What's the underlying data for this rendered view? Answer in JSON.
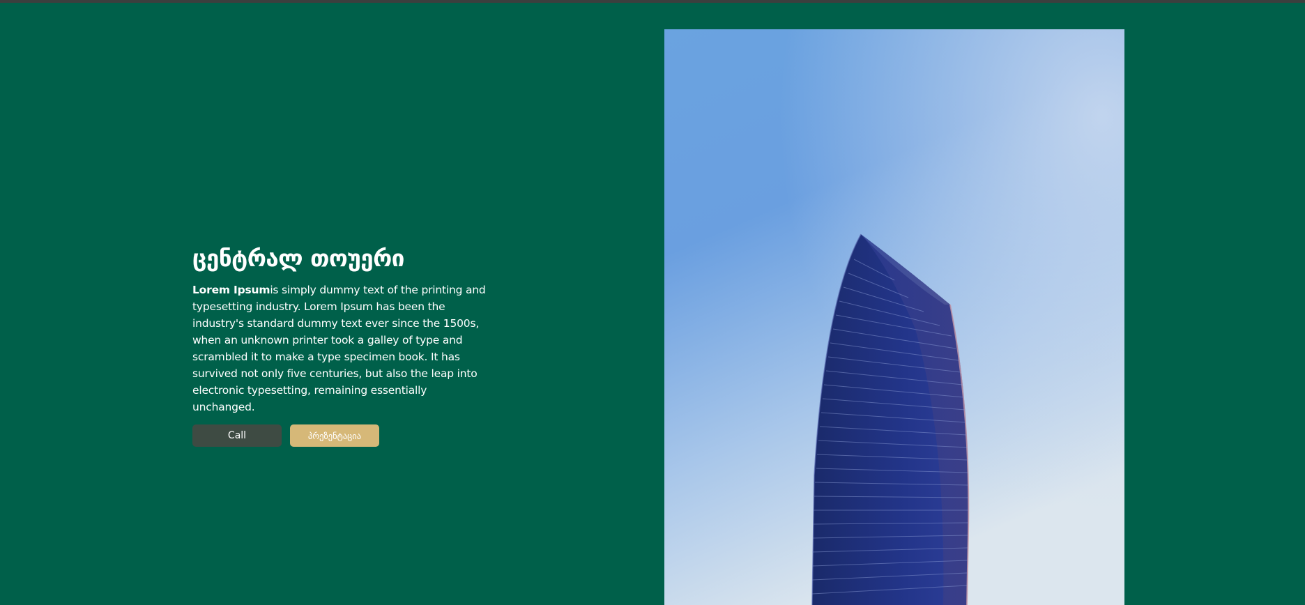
{
  "hero": {
    "title": "ცენტრალ თოუერი",
    "description_bold": "Lorem Ipsum",
    "description_rest": "is simply dummy text of the printing and typesetting industry. Lorem Ipsum has been the industry's standard dummy text ever since the 1500s, when an unknown printer took a galley of type and scrambled it to make a type specimen book. It has survived not only five centuries, but also the leap into electronic typesetting, remaining essentially unchanged."
  },
  "buttons": {
    "call_label": "Call",
    "presentation_label": "პრეზენტაცია"
  },
  "colors": {
    "page_background": "#00604a",
    "call_button": "#3e4b43",
    "presentation_button": "#d6b878",
    "text": "#ffffff"
  }
}
